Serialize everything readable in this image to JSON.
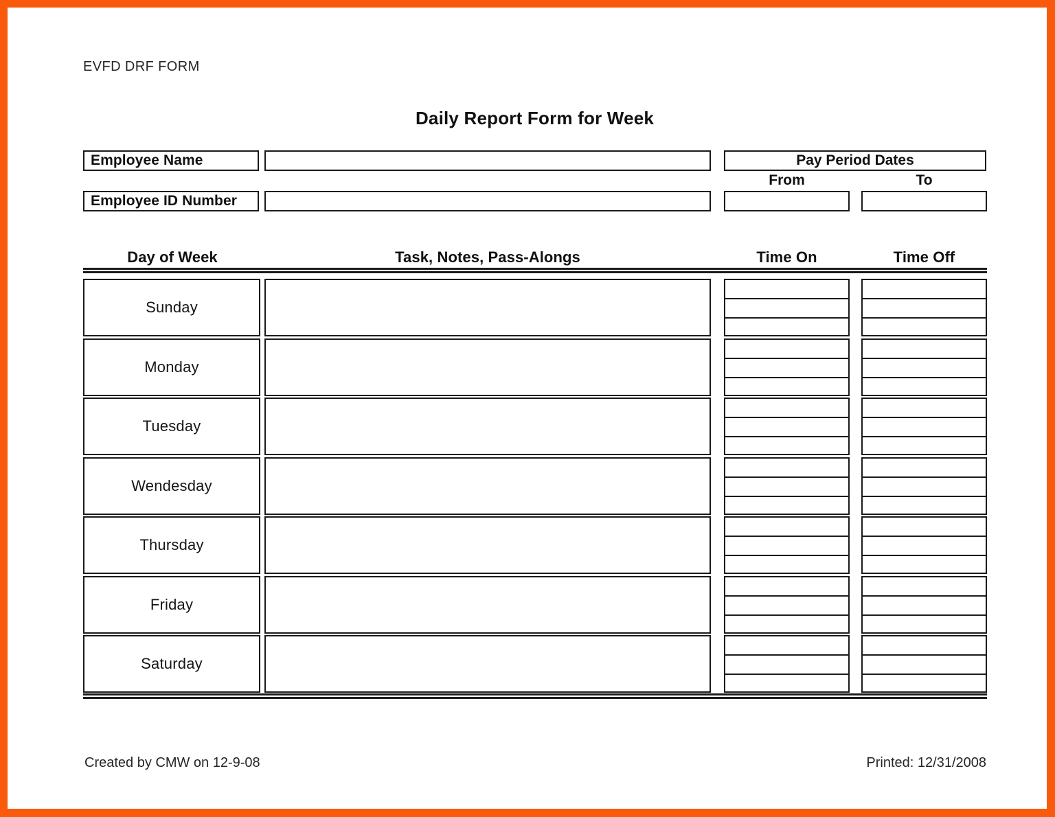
{
  "page": {
    "form_code": "EVFD DRF FORM",
    "title": "Daily Report Form for Week",
    "border_color": "#f95a0c",
    "ink_color": "#1a1a1a"
  },
  "employee": {
    "name_label": "Employee Name",
    "name_value": "",
    "id_label": "Employee ID Number",
    "id_value": ""
  },
  "pay_period": {
    "title": "Pay Period Dates",
    "from_label": "From",
    "to_label": "To",
    "from_value": "",
    "to_value": ""
  },
  "table": {
    "headers": {
      "day": "Day of Week",
      "task": "Task, Notes, Pass-Alongs",
      "time_on": "Time On",
      "time_off": "Time Off"
    },
    "sub_rows_per_time_cell": 3,
    "rows": [
      {
        "day": "Sunday",
        "task": "",
        "time_on": [
          "",
          "",
          ""
        ],
        "time_off": [
          "",
          "",
          ""
        ]
      },
      {
        "day": "Monday",
        "task": "",
        "time_on": [
          "",
          "",
          ""
        ],
        "time_off": [
          "",
          "",
          ""
        ]
      },
      {
        "day": "Tuesday",
        "task": "",
        "time_on": [
          "",
          "",
          ""
        ],
        "time_off": [
          "",
          "",
          ""
        ]
      },
      {
        "day": "Wendesday",
        "task": "",
        "time_on": [
          "",
          "",
          ""
        ],
        "time_off": [
          "",
          "",
          ""
        ]
      },
      {
        "day": "Thursday",
        "task": "",
        "time_on": [
          "",
          "",
          ""
        ],
        "time_off": [
          "",
          "",
          ""
        ]
      },
      {
        "day": "Friday",
        "task": "",
        "time_on": [
          "",
          "",
          ""
        ],
        "time_off": [
          "",
          "",
          ""
        ]
      },
      {
        "day": "Saturday",
        "task": "",
        "time_on": [
          "",
          "",
          ""
        ],
        "time_off": [
          "",
          "",
          ""
        ]
      }
    ]
  },
  "footer": {
    "created": "Created by CMW on 12-9-08",
    "printed": "Printed: 12/31/2008"
  }
}
